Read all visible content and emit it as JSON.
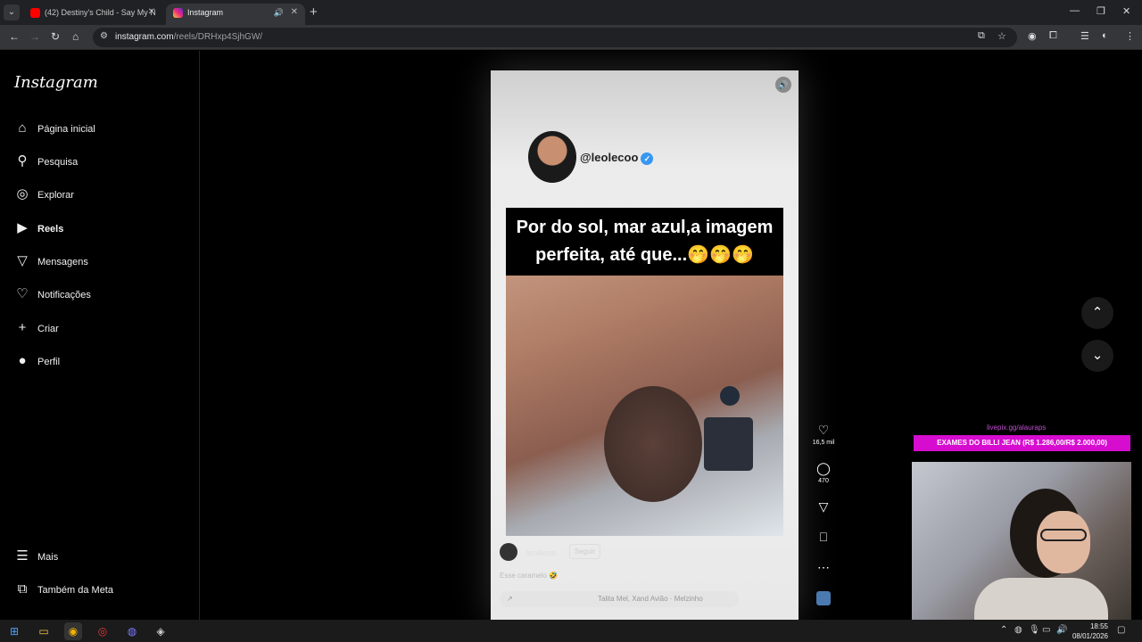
{
  "browser": {
    "tabs": [
      {
        "title": "(42) Destiny's Child - Say My N"
      },
      {
        "title": "Instagram"
      }
    ],
    "url_host": "instagram.com",
    "url_path": "/reels/DRHxp4SjhGW/"
  },
  "sidebar": {
    "logo": "Instagram",
    "items": [
      {
        "label": "Página inicial"
      },
      {
        "label": "Pesquisa"
      },
      {
        "label": "Explorar"
      },
      {
        "label": "Reels"
      },
      {
        "label": "Mensagens"
      },
      {
        "label": "Notificações"
      },
      {
        "label": "Criar"
      },
      {
        "label": "Perfil"
      }
    ],
    "bottom": [
      {
        "label": "Mais"
      },
      {
        "label": "Também da Meta"
      }
    ]
  },
  "reel": {
    "creator_handle": "@leolecoo",
    "caption_line1": "Por do sol, mar azul,a imagem",
    "caption_line2": "perfeita, até que...🤭🤭🤭",
    "username": "leolecoo",
    "follow_label": "Seguir",
    "description": "Esse caramelo 🤣",
    "music": "Talita Mel, Xand Avião · Melzinho"
  },
  "actions": {
    "likes": "16,5 mil",
    "comments": "470"
  },
  "stream_overlay": {
    "url": "livepix.gg/alauraps",
    "banner": "EXAMES DO BILLI JEAN (R$ 1.286,00/R$ 2.000,00)"
  },
  "taskbar": {
    "time": "18:55",
    "date": "08/01/2026"
  }
}
